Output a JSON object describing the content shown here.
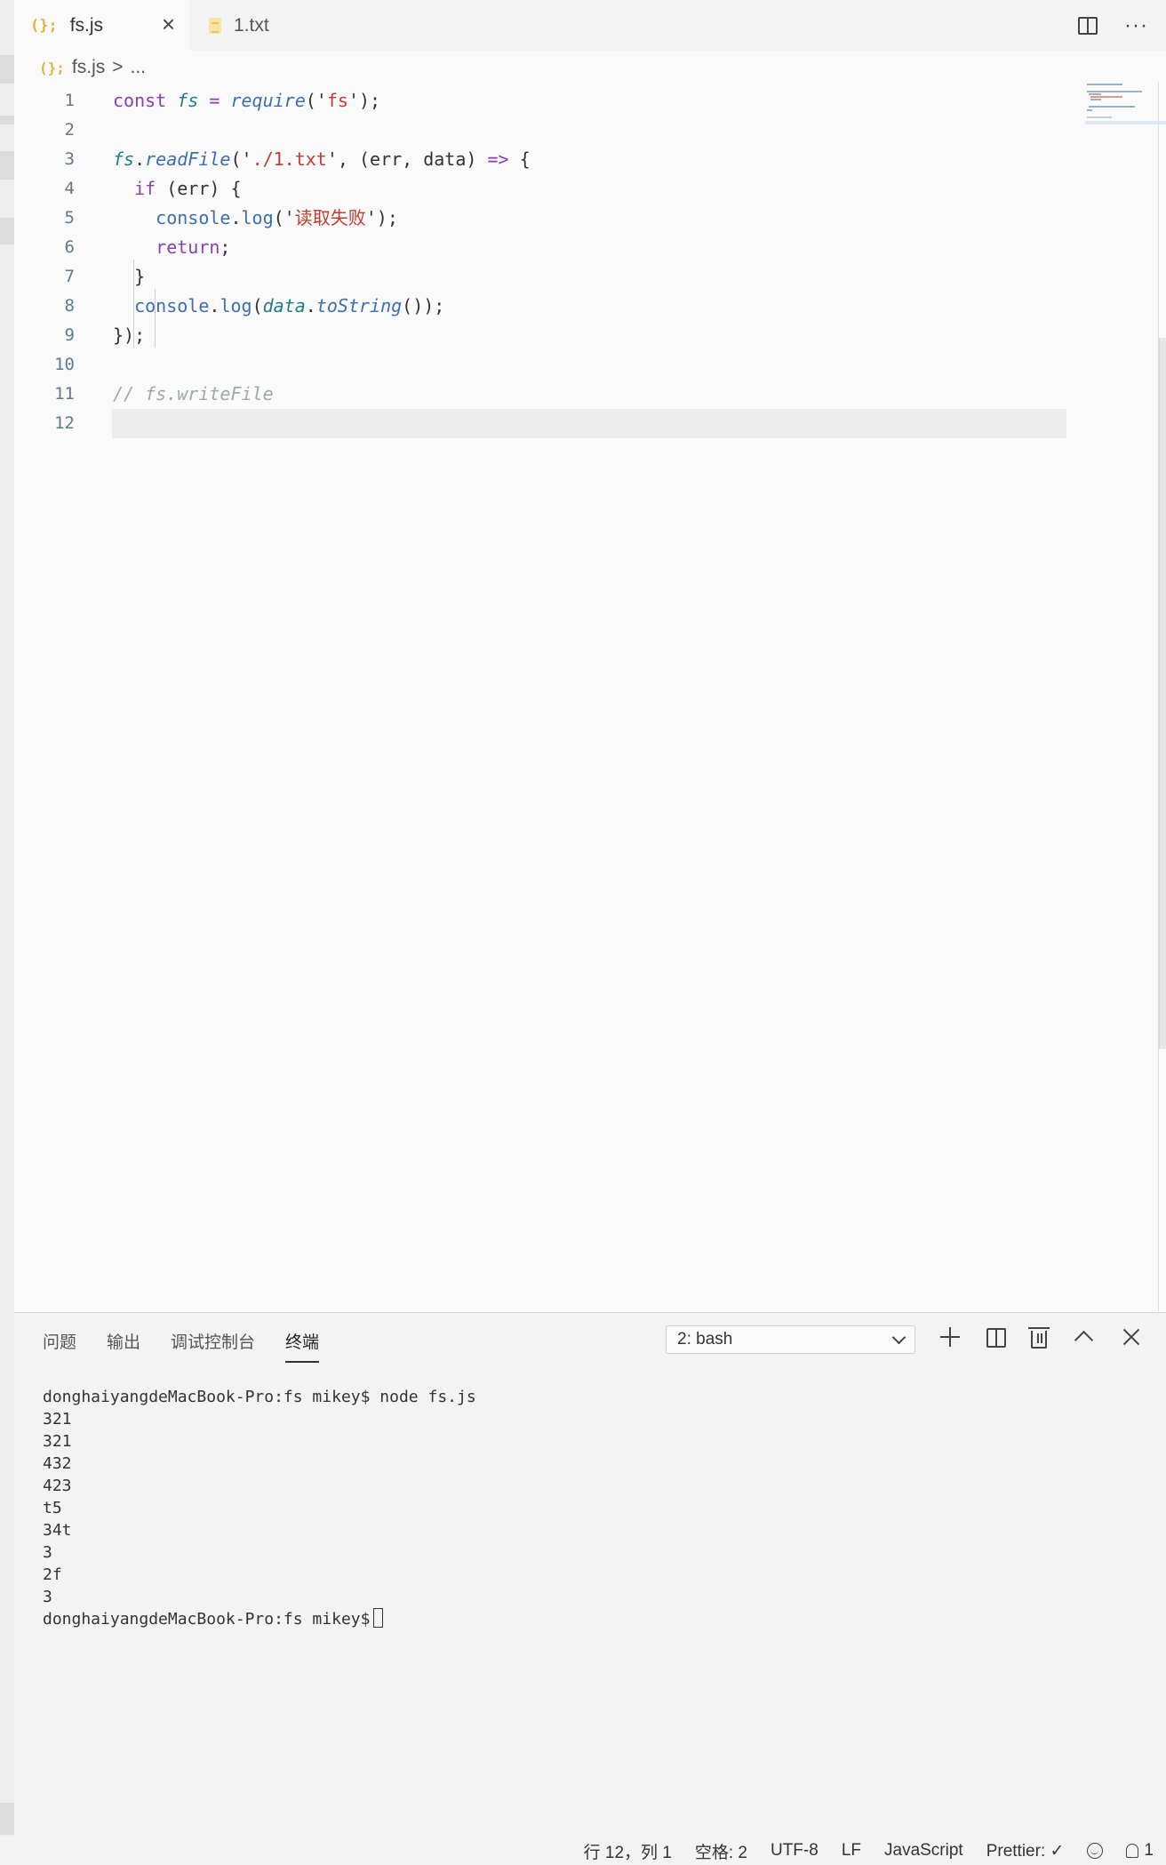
{
  "tabs": [
    {
      "label": "fs.js",
      "icon": "js-file-icon",
      "active": true
    },
    {
      "label": "1.txt",
      "icon": "text-file-icon",
      "active": false
    }
  ],
  "breadcrumb": {
    "file_icon_glyph": "(};",
    "file": "fs.js",
    "separator": ">",
    "more": "..."
  },
  "tab_file_icon_glyph": "(};",
  "editor": {
    "line_numbers": [
      "1",
      "2",
      "3",
      "4",
      "5",
      "6",
      "7",
      "8",
      "9",
      "10",
      "11",
      "12"
    ],
    "lines": [
      {
        "tokens": [
          {
            "t": "const ",
            "c": "kw"
          },
          {
            "t": "fs",
            "c": "obj"
          },
          {
            "t": " = ",
            "c": "op"
          },
          {
            "t": "require",
            "c": "fn"
          },
          {
            "t": "('",
            "c": "pl"
          },
          {
            "t": "fs",
            "c": "str"
          },
          {
            "t": "');",
            "c": "pl"
          }
        ]
      },
      {
        "tokens": []
      },
      {
        "tokens": [
          {
            "t": "fs",
            "c": "obj"
          },
          {
            "t": ".",
            "c": "pl"
          },
          {
            "t": "readFile",
            "c": "fn"
          },
          {
            "t": "('",
            "c": "pl"
          },
          {
            "t": "./1.txt",
            "c": "str"
          },
          {
            "t": "', (err, data) ",
            "c": "pl"
          },
          {
            "t": "=>",
            "c": "op"
          },
          {
            "t": " {",
            "c": "pl"
          }
        ]
      },
      {
        "tokens": [
          {
            "t": "  ",
            "c": "pl"
          },
          {
            "t": "if",
            "c": "kw"
          },
          {
            "t": " (err) {",
            "c": "pl"
          }
        ]
      },
      {
        "tokens": [
          {
            "t": "    ",
            "c": "pl"
          },
          {
            "t": "console",
            "c": "call"
          },
          {
            "t": ".",
            "c": "pl"
          },
          {
            "t": "log",
            "c": "call"
          },
          {
            "t": "('",
            "c": "pl"
          },
          {
            "t": "读取失败",
            "c": "str"
          },
          {
            "t": "');",
            "c": "pl"
          }
        ]
      },
      {
        "tokens": [
          {
            "t": "    ",
            "c": "pl"
          },
          {
            "t": "return",
            "c": "kw"
          },
          {
            "t": ";",
            "c": "pl"
          }
        ]
      },
      {
        "tokens": [
          {
            "t": "  }",
            "c": "pl"
          }
        ]
      },
      {
        "tokens": [
          {
            "t": "  ",
            "c": "pl"
          },
          {
            "t": "console",
            "c": "call"
          },
          {
            "t": ".",
            "c": "pl"
          },
          {
            "t": "log",
            "c": "call"
          },
          {
            "t": "(",
            "c": "pl"
          },
          {
            "t": "data",
            "c": "obj"
          },
          {
            "t": ".",
            "c": "pl"
          },
          {
            "t": "toString",
            "c": "fn"
          },
          {
            "t": "());",
            "c": "pl"
          }
        ]
      },
      {
        "tokens": [
          {
            "t": "});",
            "c": "pl"
          }
        ]
      },
      {
        "tokens": []
      },
      {
        "tokens": [
          {
            "t": "// fs.writeFile",
            "c": "cmt"
          }
        ]
      },
      {
        "tokens": []
      }
    ]
  },
  "panel": {
    "tabs": [
      "问题",
      "输出",
      "调试控制台",
      "终端"
    ],
    "active_tab": "终端",
    "terminal_select": "2: bash",
    "terminal_lines": [
      "donghaiyangdeMacBook-Pro:fs mikey$ node fs.js",
      "321",
      "321",
      "432",
      "423",
      "t5",
      "34t",
      "3",
      "2f",
      "3"
    ],
    "prompt": "donghaiyangdeMacBook-Pro:fs mikey$"
  },
  "status": {
    "position": "行 12，列 1",
    "spaces": "空格: 2",
    "encoding": "UTF-8",
    "eol": "LF",
    "language": "JavaScript",
    "prettier": "Prettier: ✓",
    "notifications": "1"
  },
  "colors": {
    "keyword": "#8b3fb0",
    "string": "#c23b30",
    "function": "#3c6fb0",
    "comment": "#a0a8ad"
  }
}
